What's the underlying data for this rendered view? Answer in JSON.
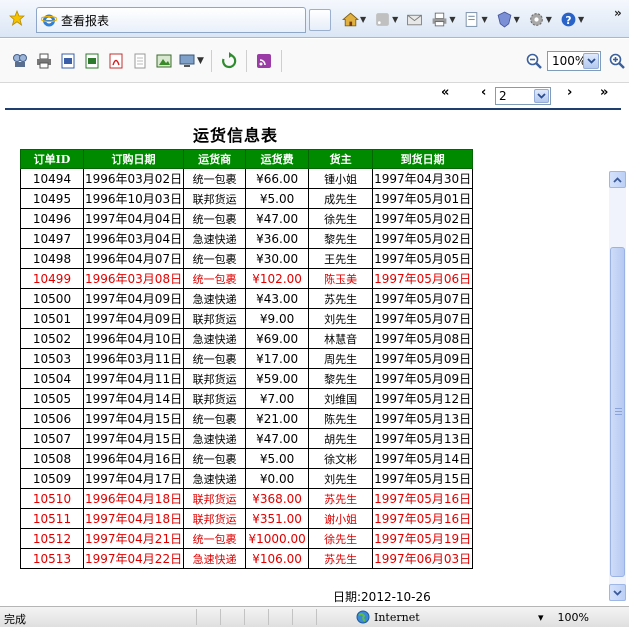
{
  "browser": {
    "tab_title": "查看报表",
    "overflow": "»"
  },
  "report_toolbar": {
    "zoom_value": "100%"
  },
  "pager": {
    "first": "«",
    "prev": "‹",
    "page_value": "2",
    "next": "›",
    "last": "»"
  },
  "report": {
    "title": "运货信息表",
    "columns": [
      "订单ID",
      "订购日期",
      "运货商",
      "运货费",
      "货主",
      "到货日期"
    ],
    "rows": [
      {
        "id": "10494",
        "order_date": "1996年03月02日",
        "shipper": "统一包裹",
        "freight": "¥66.00",
        "owner": "锺小姐",
        "arrive": "1997年04月30日",
        "red": false
      },
      {
        "id": "10495",
        "order_date": "1996年10月03日",
        "shipper": "联邦货运",
        "freight": "¥5.00",
        "owner": "成先生",
        "arrive": "1997年05月01日",
        "red": false
      },
      {
        "id": "10496",
        "order_date": "1997年04月04日",
        "shipper": "统一包裹",
        "freight": "¥47.00",
        "owner": "徐先生",
        "arrive": "1997年05月02日",
        "red": false
      },
      {
        "id": "10497",
        "order_date": "1996年03月04日",
        "shipper": "急速快递",
        "freight": "¥36.00",
        "owner": "黎先生",
        "arrive": "1997年05月02日",
        "red": false
      },
      {
        "id": "10498",
        "order_date": "1996年04月07日",
        "shipper": "统一包裹",
        "freight": "¥30.00",
        "owner": "王先生",
        "arrive": "1997年05月05日",
        "red": false
      },
      {
        "id": "10499",
        "order_date": "1996年03月08日",
        "shipper": "统一包裹",
        "freight": "¥102.00",
        "owner": "陈玉美",
        "arrive": "1997年05月06日",
        "red": true
      },
      {
        "id": "10500",
        "order_date": "1997年04月09日",
        "shipper": "急速快递",
        "freight": "¥43.00",
        "owner": "苏先生",
        "arrive": "1997年05月07日",
        "red": false
      },
      {
        "id": "10501",
        "order_date": "1997年04月09日",
        "shipper": "联邦货运",
        "freight": "¥9.00",
        "owner": "刘先生",
        "arrive": "1997年05月07日",
        "red": false
      },
      {
        "id": "10502",
        "order_date": "1996年04月10日",
        "shipper": "急速快递",
        "freight": "¥69.00",
        "owner": "林慧音",
        "arrive": "1997年05月08日",
        "red": false
      },
      {
        "id": "10503",
        "order_date": "1996年03月11日",
        "shipper": "统一包裹",
        "freight": "¥17.00",
        "owner": "周先生",
        "arrive": "1997年05月09日",
        "red": false
      },
      {
        "id": "10504",
        "order_date": "1997年04月11日",
        "shipper": "联邦货运",
        "freight": "¥59.00",
        "owner": "黎先生",
        "arrive": "1997年05月09日",
        "red": false
      },
      {
        "id": "10505",
        "order_date": "1997年04月14日",
        "shipper": "联邦货运",
        "freight": "¥7.00",
        "owner": "刘维国",
        "arrive": "1997年05月12日",
        "red": false
      },
      {
        "id": "10506",
        "order_date": "1997年04月15日",
        "shipper": "统一包裹",
        "freight": "¥21.00",
        "owner": "陈先生",
        "arrive": "1997年05月13日",
        "red": false
      },
      {
        "id": "10507",
        "order_date": "1997年04月15日",
        "shipper": "急速快递",
        "freight": "¥47.00",
        "owner": "胡先生",
        "arrive": "1997年05月13日",
        "red": false
      },
      {
        "id": "10508",
        "order_date": "1996年04月16日",
        "shipper": "统一包裹",
        "freight": "¥5.00",
        "owner": "徐文彬",
        "arrive": "1997年05月14日",
        "red": false
      },
      {
        "id": "10509",
        "order_date": "1997年04月17日",
        "shipper": "急速快递",
        "freight": "¥0.00",
        "owner": "刘先生",
        "arrive": "1997年05月15日",
        "red": false
      },
      {
        "id": "10510",
        "order_date": "1996年04月18日",
        "shipper": "联邦货运",
        "freight": "¥368.00",
        "owner": "苏先生",
        "arrive": "1997年05月16日",
        "red": true
      },
      {
        "id": "10511",
        "order_date": "1997年04月18日",
        "shipper": "联邦货运",
        "freight": "¥351.00",
        "owner": "谢小姐",
        "arrive": "1997年05月16日",
        "red": true
      },
      {
        "id": "10512",
        "order_date": "1997年04月21日",
        "shipper": "统一包裹",
        "freight": "¥1000.00",
        "owner": "徐先生",
        "arrive": "1997年05月19日",
        "red": true
      },
      {
        "id": "10513",
        "order_date": "1997年04月22日",
        "shipper": "急速快递",
        "freight": "¥106.00",
        "owner": "苏先生",
        "arrive": "1997年06月03日",
        "red": true
      }
    ],
    "date_label": "日期:",
    "date_value": "2012-10-26"
  },
  "statusbar": {
    "status": "完成",
    "zone": "Internet",
    "zoom": "100%"
  },
  "colors": {
    "header_green": "#008a00",
    "highlight_red": "#e00000"
  }
}
